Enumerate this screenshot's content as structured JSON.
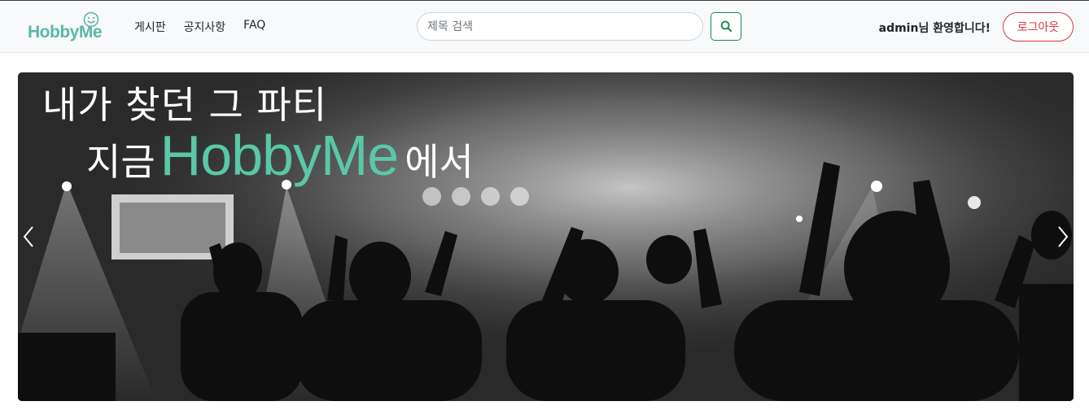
{
  "navbar": {
    "logo_text": "HobbyMe",
    "links": [
      {
        "label": "게시판"
      },
      {
        "label": "공지사항"
      },
      {
        "label": "FAQ"
      }
    ],
    "search_placeholder": "제목 검색",
    "welcome_text": "admin님 환영합니다!",
    "logout_label": "로그아웃"
  },
  "carousel": {
    "headline_line1": "내가 찾던 그 파티",
    "headline_line2_prefix": "지금",
    "headline_brand": "HobbyMe",
    "headline_line2_suffix": "에서",
    "slide_count": 4,
    "active_index": 0
  },
  "colors": {
    "brand": "#5bb8a6",
    "headline_brand": "#59c8a7",
    "search_button": "#198754",
    "logout": "#dc3545"
  },
  "icons": {
    "search": "search-icon",
    "prev": "chevron-left-icon",
    "next": "chevron-right-icon",
    "logo": "smile-icon"
  }
}
